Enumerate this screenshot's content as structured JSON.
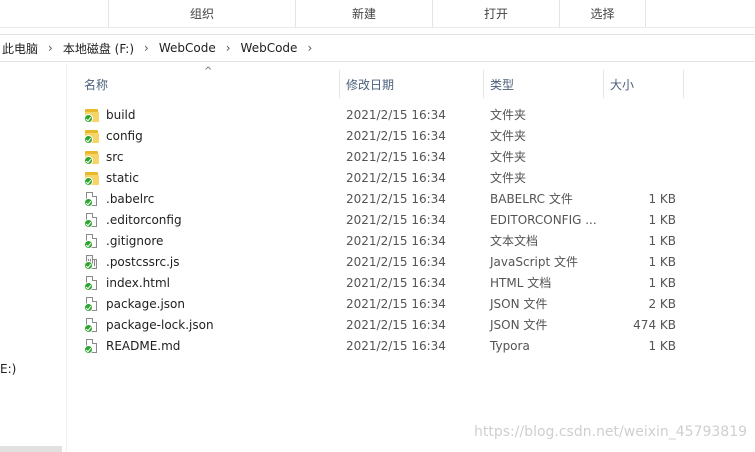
{
  "ribbon": {
    "groups": [
      "组织",
      "新建",
      "打开",
      "选择"
    ]
  },
  "address": {
    "crumbs": [
      "此电脑",
      "本地磁盘 (F:)",
      "WebCode",
      "WebCode"
    ],
    "separator": "›"
  },
  "nav": {
    "drive_label": "E:)"
  },
  "columns": {
    "name": "名称",
    "date": "修改日期",
    "type": "类型",
    "size": "大小"
  },
  "files": [
    {
      "name": "build",
      "date": "2021/2/15 16:34",
      "type": "文件夹",
      "size": "",
      "icon": "folder-icon"
    },
    {
      "name": "config",
      "date": "2021/2/15 16:34",
      "type": "文件夹",
      "size": "",
      "icon": "folder-icon"
    },
    {
      "name": "src",
      "date": "2021/2/15 16:34",
      "type": "文件夹",
      "size": "",
      "icon": "folder-icon"
    },
    {
      "name": "static",
      "date": "2021/2/15 16:34",
      "type": "文件夹",
      "size": "",
      "icon": "folder-icon"
    },
    {
      "name": ".babelrc",
      "date": "2021/2/15 16:34",
      "type": "BABELRC 文件",
      "size": "1 KB",
      "icon": "file-icon"
    },
    {
      "name": ".editorconfig",
      "date": "2021/2/15 16:34",
      "type": "EDITORCONFIG ...",
      "size": "1 KB",
      "icon": "file-icon"
    },
    {
      "name": ".gitignore",
      "date": "2021/2/15 16:34",
      "type": "文本文档",
      "size": "1 KB",
      "icon": "file-icon"
    },
    {
      "name": ".postcssrc.js",
      "date": "2021/2/15 16:34",
      "type": "JavaScript 文件",
      "size": "1 KB",
      "icon": "js-file-icon"
    },
    {
      "name": "index.html",
      "date": "2021/2/15 16:34",
      "type": "HTML 文档",
      "size": "1 KB",
      "icon": "file-icon"
    },
    {
      "name": "package.json",
      "date": "2021/2/15 16:34",
      "type": "JSON 文件",
      "size": "2 KB",
      "icon": "file-icon"
    },
    {
      "name": "package-lock.json",
      "date": "2021/2/15 16:34",
      "type": "JSON 文件",
      "size": "474 KB",
      "icon": "file-icon"
    },
    {
      "name": "README.md",
      "date": "2021/2/15 16:34",
      "type": "Typora",
      "size": "1 KB",
      "icon": "file-icon"
    }
  ],
  "watermark": "https://blog.csdn.net/weixin_45793819",
  "colors": {
    "header_text": "#4c607a",
    "folder": "#f7d468",
    "sync_check": "#2fa52f"
  }
}
